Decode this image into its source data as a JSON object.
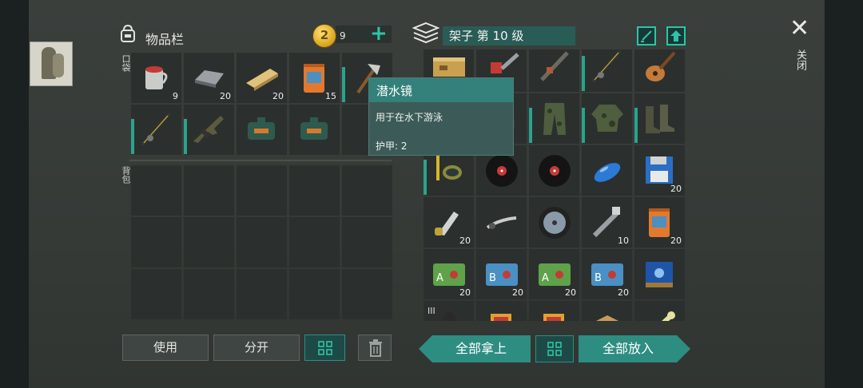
{
  "inventory": {
    "title": "物品栏",
    "pocket_label": "口袋",
    "backpack_label": "背包",
    "coins": "9",
    "pocket_items": [
      {
        "name": "cup-of-water-icon",
        "count": "9"
      },
      {
        "name": "metal-ingot-icon",
        "count": "20"
      },
      {
        "name": "wood-plank-icon",
        "count": "20"
      },
      {
        "name": "food-bag-icon",
        "count": "15"
      },
      {
        "name": "axe-icon",
        "count": ""
      },
      {
        "name": "fishing-rod-icon",
        "count": ""
      },
      {
        "name": "rifle-icon",
        "count": ""
      },
      {
        "name": "ammo-box-icon",
        "count": ""
      },
      {
        "name": "ammo-box-icon",
        "count": ""
      }
    ]
  },
  "actions": {
    "use": "使用",
    "split": "分开"
  },
  "shelf": {
    "title": "架子 第 10 级",
    "take_all": "全部拿上",
    "put_all": "全部放入",
    "roman": "III",
    "items": [
      {
        "name": "crate-icon",
        "count": ""
      },
      {
        "name": "chainsaw-icon",
        "count": ""
      },
      {
        "name": "gun-parts-icon",
        "count": ""
      },
      {
        "name": "fishing-rod-icon",
        "count": ""
      },
      {
        "name": "guitar-icon",
        "count": ""
      },
      {
        "name": "diving-mask-icon",
        "count": ""
      },
      {
        "name": "helmet-icon",
        "count": ""
      },
      {
        "name": "camo-pants-icon",
        "count": ""
      },
      {
        "name": "camo-jacket-icon",
        "count": ""
      },
      {
        "name": "boots-icon",
        "count": ""
      },
      {
        "name": "snorkel-goggles-icon",
        "count": ""
      },
      {
        "name": "vinyl-record-icon",
        "count": ""
      },
      {
        "name": "vinyl-record-icon",
        "count": ""
      },
      {
        "name": "fuel-tank-icon",
        "count": ""
      },
      {
        "name": "floppy-disk-icon",
        "count": "20"
      },
      {
        "name": "knife-part-icon",
        "count": "20"
      },
      {
        "name": "brake-lever-icon",
        "count": ""
      },
      {
        "name": "wheel-icon",
        "count": ""
      },
      {
        "name": "spark-plug-icon",
        "count": "10"
      },
      {
        "name": "food-bag-icon",
        "count": "20"
      },
      {
        "name": "sector-a-card-icon",
        "count": "20"
      },
      {
        "name": "sector-b-card-icon",
        "count": "20"
      },
      {
        "name": "sector-a-card-icon",
        "count": "20"
      },
      {
        "name": "sector-b-card-icon",
        "count": "20"
      },
      {
        "name": "blue-crate-icon",
        "count": ""
      },
      {
        "name": "figure-icon",
        "count": ""
      },
      {
        "name": "card-pack-icon",
        "count": ""
      },
      {
        "name": "card-pack-icon",
        "count": ""
      },
      {
        "name": "cardboard-box-icon",
        "count": ""
      },
      {
        "name": "bone-icon",
        "count": ""
      }
    ]
  },
  "tooltip": {
    "name": "潜水镜",
    "desc": "用于在水下游泳",
    "armor": "护甲: 2"
  },
  "close_label": "关闭"
}
